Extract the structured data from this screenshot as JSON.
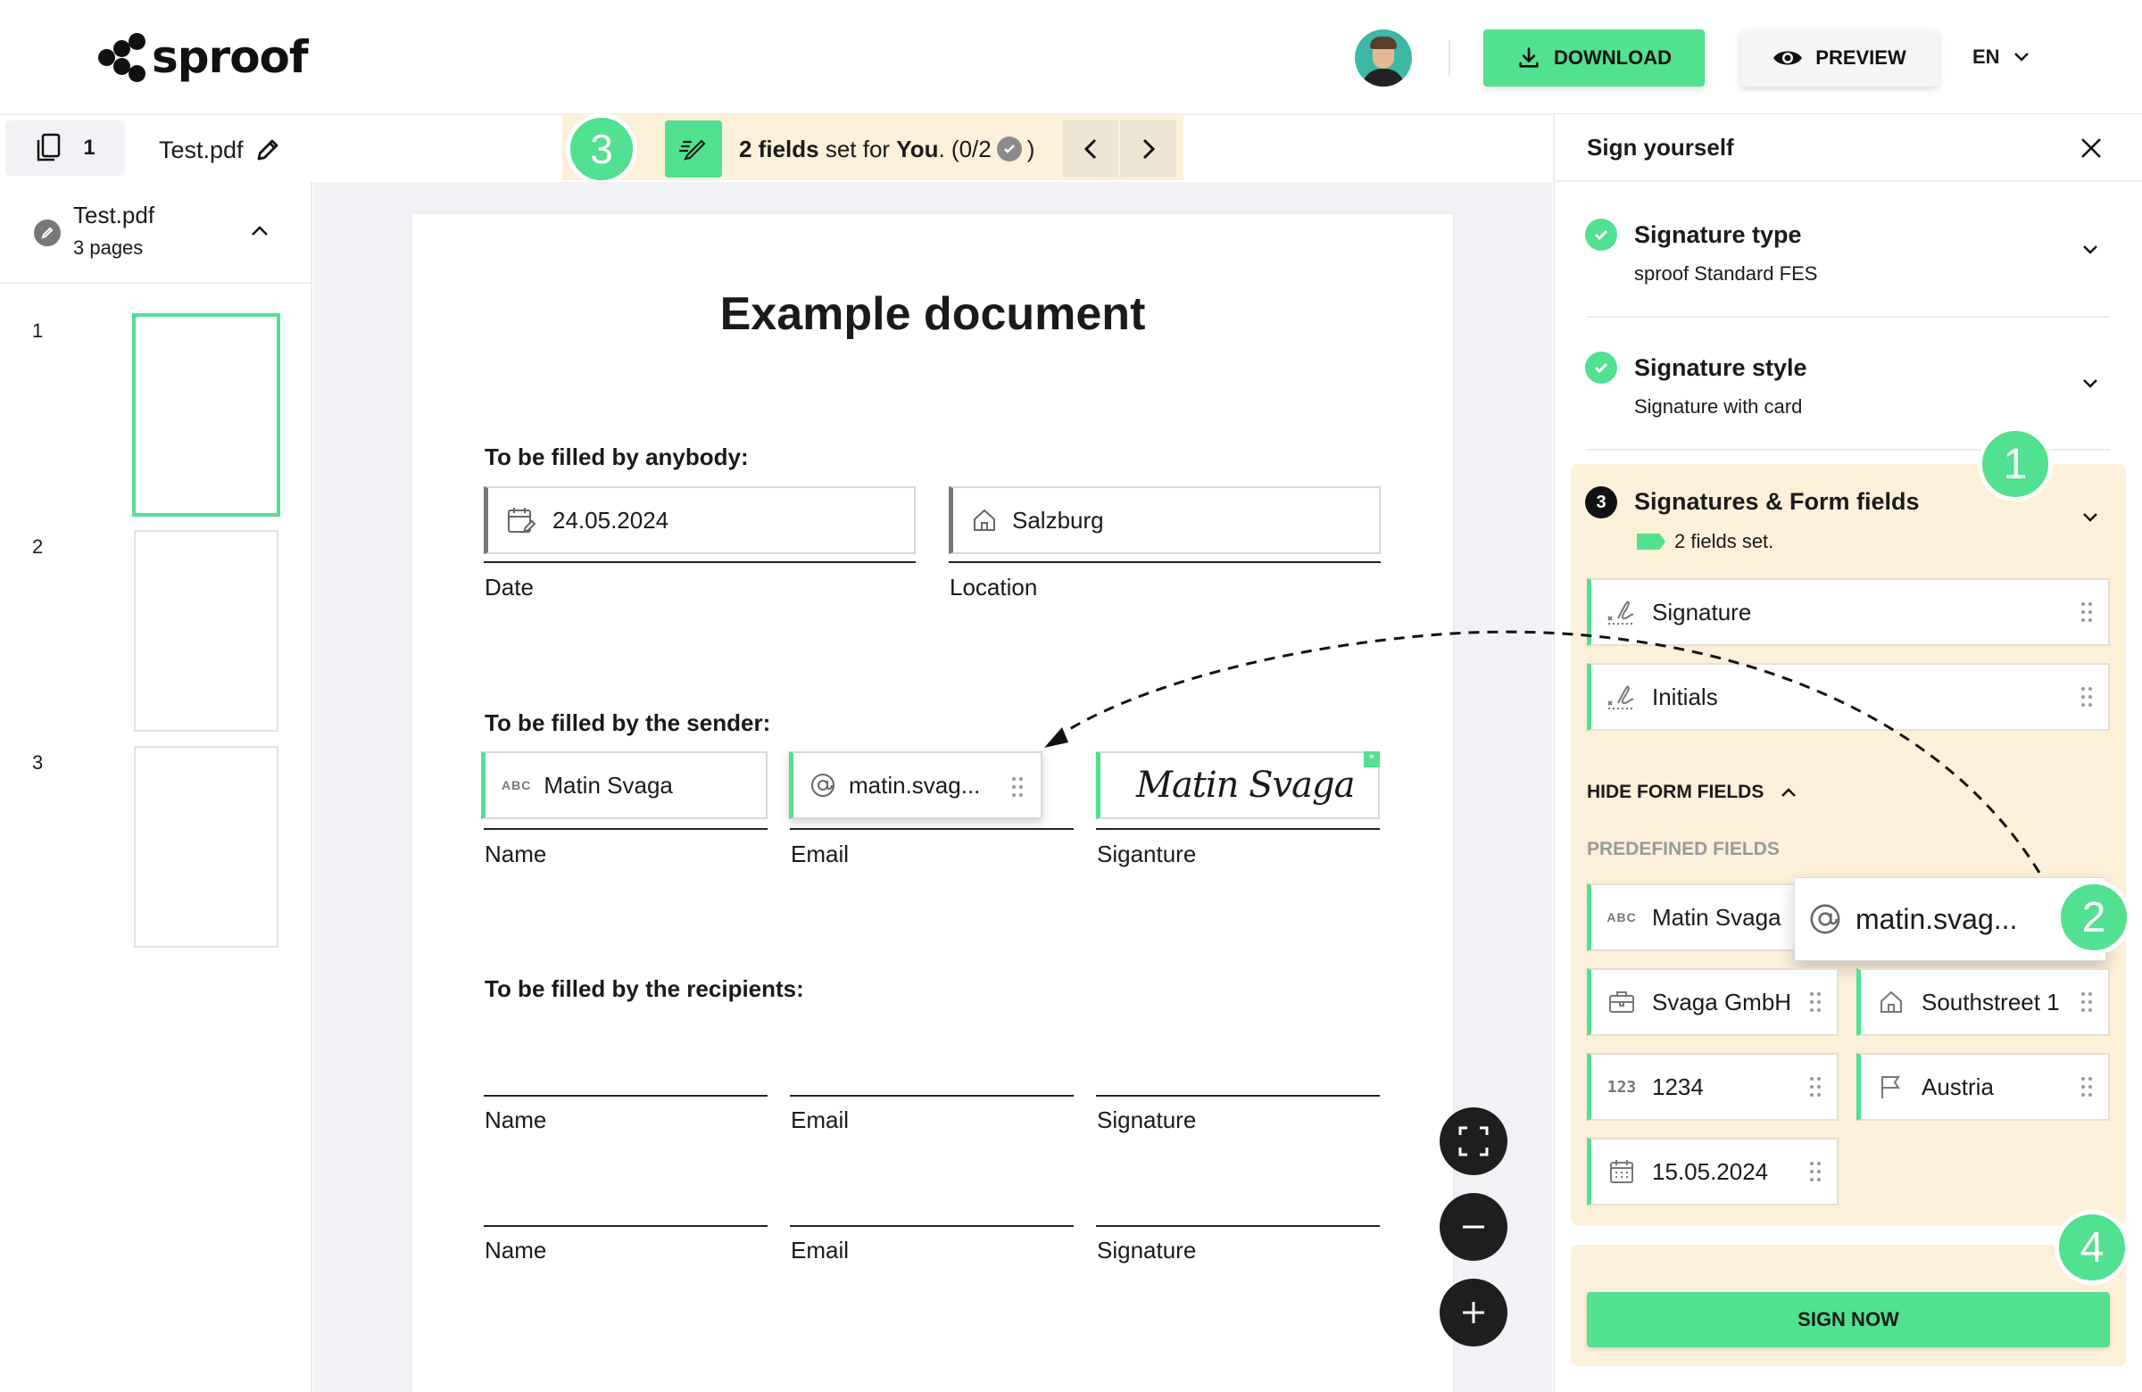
{
  "app": {
    "logo_text": "sproof",
    "download_label": "DOWNLOAD",
    "preview_label": "PREVIEW",
    "language": "EN"
  },
  "subbar": {
    "page_count": "1",
    "file_name": "Test.pdf",
    "hint_badge": "3",
    "hint_bold": "2 fields",
    "hint_mid": " set for ",
    "hint_you": "You",
    "hint_tail": ". (0/2",
    "hint_close": ")"
  },
  "left": {
    "file_title": "Test.pdf",
    "file_pages": "3 pages",
    "thumbs": [
      "1",
      "2",
      "3"
    ]
  },
  "document": {
    "title": "Example document",
    "section_anybody": "To be filled by anybody:",
    "date_value": "24.05.2024",
    "date_label": "Date",
    "location_value": "Salzburg",
    "location_label": "Location",
    "section_sender": "To be filled by the sender:",
    "name_value": "Matin Svaga",
    "name_label": "Name",
    "email_value": "matin.svag...",
    "email_label": "Email",
    "signature_script": "Matin Svaga",
    "signature_label": "Siganture",
    "section_recipients": "To be filled by the recipients:",
    "rec_row1": [
      "Name",
      "Email",
      "Signature"
    ],
    "rec_row2": [
      "Name",
      "Email",
      "Signature"
    ]
  },
  "panel": {
    "title": "Sign yourself",
    "signature_type_title": "Signature type",
    "signature_type_value": "sproof Standard FES",
    "signature_style_title": "Signature style",
    "signature_style_value": "Signature with card",
    "step_number": "3",
    "sf_title": "Signatures & Form fields",
    "sf_status": "2 fields set.",
    "sig_fields": [
      "Signature",
      "Initials"
    ],
    "hide_label": "HIDE FORM FIELDS",
    "predefined_label": "PREDEFINED FIELDS",
    "predefined": {
      "name": "Matin Svaga",
      "email": "matin.svag...",
      "company": "Svaga GmbH",
      "street": "Southstreet 1",
      "number": "1234",
      "country": "Austria",
      "date": "15.05.2024"
    },
    "sign_now": "SIGN NOW"
  },
  "badges": {
    "one": "1",
    "two": "2",
    "four": "4"
  },
  "colors": {
    "accent": "#52e091",
    "highlight": "#fdf0d8",
    "dark": "#1e1e1e"
  }
}
